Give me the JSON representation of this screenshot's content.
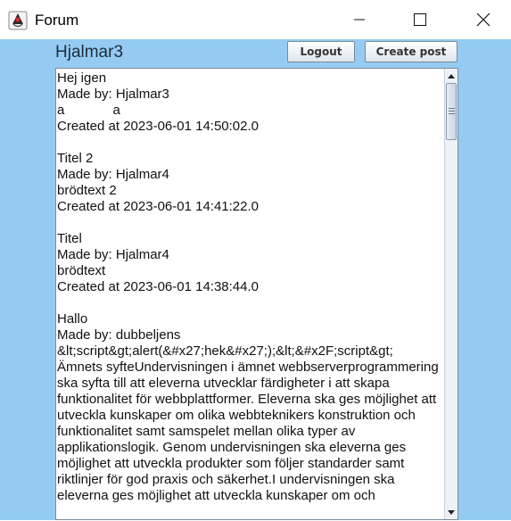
{
  "window": {
    "title": "Forum",
    "icon": "java-duke-icon",
    "buttons": [
      "minimize-icon",
      "maximize-icon",
      "close-icon"
    ]
  },
  "header": {
    "username": "Hjalmar3",
    "logout_label": "Logout",
    "create_post_label": "Create post"
  },
  "colors": {
    "background": "#95cbf2",
    "text_area": "#ffffff",
    "username_text": "#1f2d3b"
  },
  "posts": [
    {
      "title": "Hej igen",
      "author": "Made by: Hjalmar3",
      "body": "a             a",
      "created": "Created at 2023-06-01 14:50:02.0"
    },
    {
      "title": "Titel 2",
      "author": "Made by: Hjalmar4",
      "body": "brödtext 2",
      "created": "Created at 2023-06-01 14:41:22.0"
    },
    {
      "title": "Titel",
      "author": "Made by: Hjalmar4",
      "body": "brödtext",
      "created": "Created at 2023-06-01 14:38:44.0"
    },
    {
      "title": "Hallo",
      "author": "Made by: dubbeljens",
      "body": "&lt;script&gt;alert(&#x27;hek&#x27;);&lt;&#x2F;script&gt;\nÄmnets syfteUndervisningen i ämnet webbserverprogrammering ska syfta till att eleverna utvecklar färdigheter i att skapa funktionalitet för webbplattformer. Eleverna ska ges möjlighet att utveckla kunskaper om olika webbteknikers konstruktion och funktionalitet samt samspelet mellan olika typer av applikationslogik. Genom undervisningen ska eleverna ges möjlighet att utveckla produkter som följer standarder samt riktlinjer för god praxis och säkerhet.I undervisningen ska eleverna ges möjlighet att utveckla kunskaper om och",
      "created": ""
    }
  ]
}
